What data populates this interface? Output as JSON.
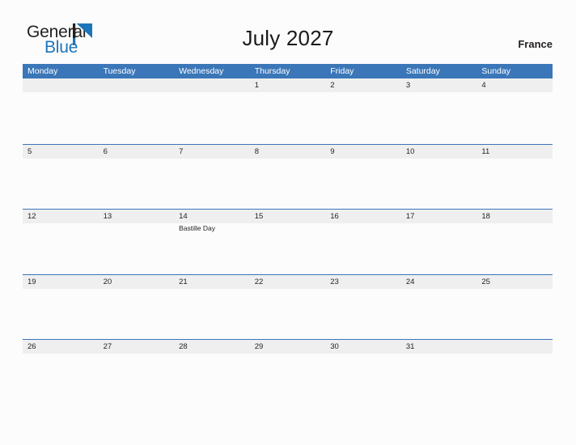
{
  "brand": {
    "word_one": "General",
    "word_two": "Blue",
    "mark_icon": "flag-triangle-icon",
    "color_dark": "#231f20",
    "color_blue": "#1b75bb"
  },
  "header": {
    "title": "July 2027",
    "country": "France"
  },
  "theme": {
    "header_blue": "#3a76b8",
    "row_band_gray": "#efefef",
    "page_background": "#fcfcfd",
    "text": "#231f20"
  },
  "calendar": {
    "weekday_headers": [
      "Monday",
      "Tuesday",
      "Wednesday",
      "Thursday",
      "Friday",
      "Saturday",
      "Sunday"
    ],
    "weeks": [
      [
        {
          "day": ""
        },
        {
          "day": ""
        },
        {
          "day": ""
        },
        {
          "day": "1"
        },
        {
          "day": "2"
        },
        {
          "day": "3"
        },
        {
          "day": "4"
        }
      ],
      [
        {
          "day": "5"
        },
        {
          "day": "6"
        },
        {
          "day": "7"
        },
        {
          "day": "8"
        },
        {
          "day": "9"
        },
        {
          "day": "10"
        },
        {
          "day": "11"
        }
      ],
      [
        {
          "day": "12"
        },
        {
          "day": "13"
        },
        {
          "day": "14",
          "event": "Bastille Day"
        },
        {
          "day": "15"
        },
        {
          "day": "16"
        },
        {
          "day": "17"
        },
        {
          "day": "18"
        }
      ],
      [
        {
          "day": "19"
        },
        {
          "day": "20"
        },
        {
          "day": "21"
        },
        {
          "day": "22"
        },
        {
          "day": "23"
        },
        {
          "day": "24"
        },
        {
          "day": "25"
        }
      ],
      [
        {
          "day": "26"
        },
        {
          "day": "27"
        },
        {
          "day": "28"
        },
        {
          "day": "29"
        },
        {
          "day": "30"
        },
        {
          "day": "31"
        },
        {
          "day": ""
        }
      ]
    ]
  }
}
